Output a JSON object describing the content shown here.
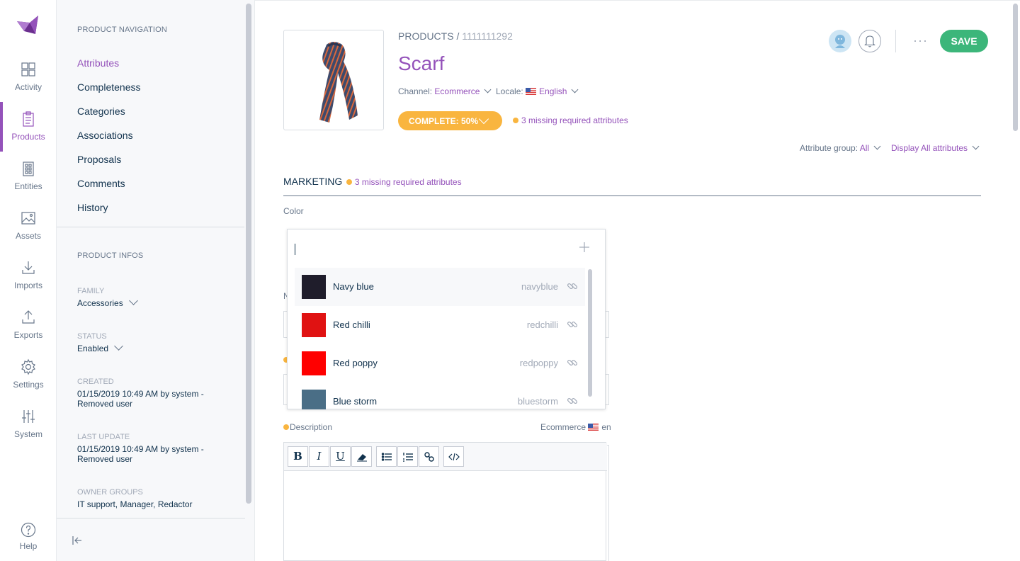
{
  "mainnav": {
    "items": [
      {
        "label": "Activity"
      },
      {
        "label": "Products"
      },
      {
        "label": "Entities"
      },
      {
        "label": "Assets"
      },
      {
        "label": "Imports"
      },
      {
        "label": "Exports"
      },
      {
        "label": "Settings"
      },
      {
        "label": "System"
      }
    ],
    "help": "Help",
    "accent": "#9452ba"
  },
  "colnav": {
    "heading": "PRODUCT NAVIGATION",
    "links": [
      "Attributes",
      "Completeness",
      "Categories",
      "Associations",
      "Proposals",
      "Comments",
      "History"
    ],
    "infos_heading": "PRODUCT INFOS",
    "family_label": "FAMILY",
    "family_value": "Accessories",
    "status_label": "STATUS",
    "status_value": "Enabled",
    "created_label": "CREATED",
    "created_value": "01/15/2019 10:49 AM by system - Removed user",
    "updated_label": "LAST UPDATE",
    "updated_value": "01/15/2019 10:49 AM by system - Removed user",
    "owner_label": "OWNER GROUPS",
    "owner_value": "IT support, Manager, Redactor"
  },
  "header": {
    "crumb_root": "PRODUCTS /",
    "crumb_id": "1111111292",
    "title": "Scarf",
    "channel_label": "Channel:",
    "channel_value": "Ecommerce",
    "locale_label": "Locale:",
    "locale_value": "English",
    "complete_label": "COMPLETE: 50%",
    "missing": "3 missing required attributes",
    "save": "SAVE",
    "more": "···"
  },
  "filters": {
    "group_label": "Attribute group:",
    "group_value": "All",
    "display": "Display All attributes"
  },
  "section": {
    "name": "MARKETING",
    "missing": "3 missing required attributes"
  },
  "fields": {
    "color_label": "Color",
    "name_peek": "N",
    "description_label": "Description",
    "description_scope": "Ecommerce",
    "description_locale": "en"
  },
  "color_options": [
    {
      "label": "Navy blue",
      "code": "navyblue",
      "color": "#1f1d2b"
    },
    {
      "label": "Red chilli",
      "code": "redchilli",
      "color": "#e01212"
    },
    {
      "label": "Red poppy",
      "code": "redpoppy",
      "color": "#ff0000"
    },
    {
      "label": "Blue storm",
      "code": "bluestorm",
      "color": "#4a6e86"
    }
  ],
  "editor_buttons": [
    "B",
    "I",
    "U"
  ]
}
